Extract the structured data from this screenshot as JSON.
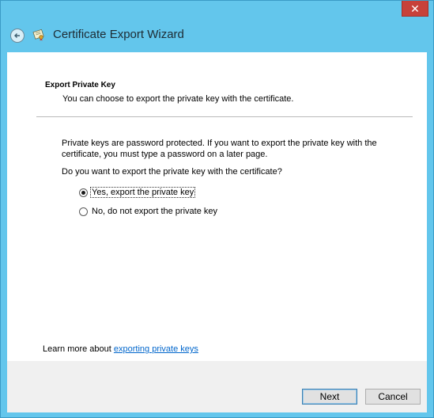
{
  "window": {
    "title": "Certificate Export Wizard",
    "close_glyph": "✕"
  },
  "section": {
    "title": "Export Private Key",
    "subtitle": "You can choose to export the private key with the certificate."
  },
  "description": "Private keys are password protected. If you want to export the private key with the certificate, you must type a password on a later page.",
  "question": "Do you want to export the private key with the certificate?",
  "options": [
    {
      "label": "Yes, export the private key",
      "checked": true
    },
    {
      "label": "No, do not export the private key",
      "checked": false
    }
  ],
  "learn_more": {
    "prefix": "Learn more about ",
    "link": "exporting private keys"
  },
  "buttons": {
    "next": "Next",
    "cancel": "Cancel"
  },
  "colors": {
    "chrome": "#63c6ec",
    "close": "#c7413a",
    "link": "#0066cc"
  }
}
